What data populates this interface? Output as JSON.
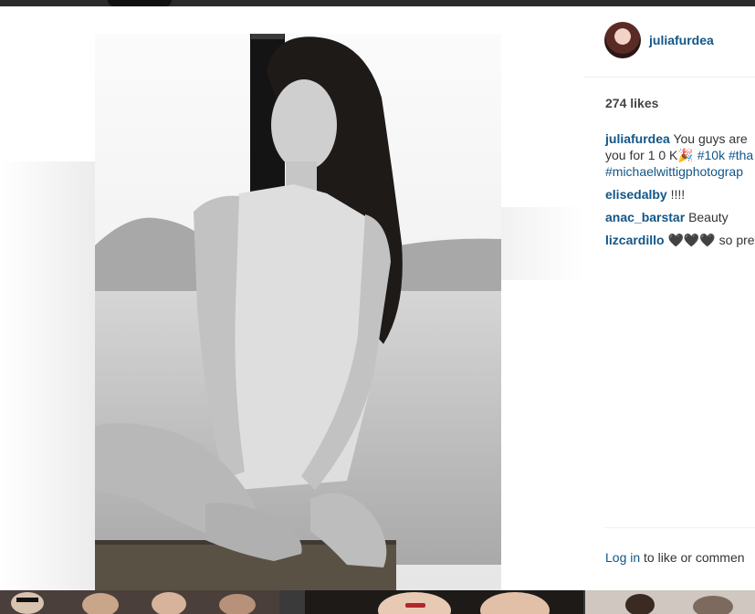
{
  "post": {
    "username": "juliafurdea",
    "likes_text": "274 likes",
    "caption_line1": "You guys are",
    "caption_line2_text": "you for 1 0 K",
    "caption_emoji": "🎉",
    "caption_tag1": "#10k",
    "caption_tag2": "#tha",
    "caption_tag3": "#michaelwittigphotograp"
  },
  "comments": [
    {
      "user": "elisedalby",
      "text": "!!!!"
    },
    {
      "user": "anac_barstar",
      "text": "Beauty"
    },
    {
      "user": "lizcardillo",
      "text": "🖤🖤🖤 so pret"
    }
  ],
  "footer": {
    "login_link": "Log in",
    "rest": "to like or commen"
  },
  "colors": {
    "link": "#125688",
    "text": "#333333",
    "likes": "#444444",
    "overlay": "#3a3a3a"
  }
}
